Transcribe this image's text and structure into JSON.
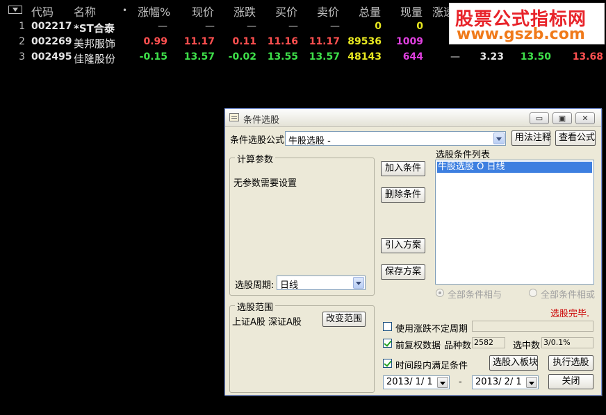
{
  "table": {
    "headers": {
      "code": "代码",
      "name": "名称",
      "dot": "•",
      "change_pct": "涨幅%",
      "price": "现价",
      "change": "涨跌",
      "bid": "买价",
      "ask": "卖价",
      "volume": "总量",
      "cur_volume": "现量",
      "speed": "涨速"
    },
    "rows": [
      {
        "idx": "1",
        "code": "002217",
        "name": "*ST合泰",
        "change_pct": "—",
        "price": "—",
        "change": "—",
        "bid": "—",
        "ask": "—",
        "volume": "0",
        "cur_volume": "0",
        "speed": "",
        "open": "",
        "high": "",
        "low": ""
      },
      {
        "idx": "2",
        "code": "002269",
        "name": "美邦服饰",
        "change_pct": "0.99",
        "price": "11.17",
        "change": "0.11",
        "bid": "11.16",
        "ask": "11.17",
        "volume": "89536",
        "cur_volume": "1009",
        "speed": "",
        "open": "",
        "high": "",
        "low": ""
      },
      {
        "idx": "3",
        "code": "002495",
        "name": "佳隆股份",
        "change_pct": "-0.15",
        "price": "13.57",
        "change": "-0.02",
        "bid": "13.55",
        "ask": "13.57",
        "volume": "48143",
        "cur_volume": "644",
        "speed": "—",
        "open": "3.23",
        "high": "13.50",
        "low": "13.68"
      }
    ]
  },
  "watermark": {
    "line1": "股票公式指标网",
    "line2": "www.gszb.com"
  },
  "dialog": {
    "title": "条件选股",
    "formula_label": "条件选股公式",
    "formula_value": "牛股选股 -",
    "usage_button": "用法注释",
    "view_formula_button": "查看公式",
    "calc_params_legend": "计算参数",
    "no_params_text": "无参数需要设置",
    "period_label": "选股周期:",
    "period_value": "日线",
    "add_condition_button": "加入条件",
    "delete_condition_button": "删除条件",
    "import_plan_button": "引入方案",
    "save_plan_button": "保存方案",
    "condition_list_label": "选股条件列表",
    "condition_items": [
      "牛股选股  O  日线"
    ],
    "radio_and_label": "全部条件相与",
    "radio_or_label": "全部条件相或",
    "status_text": "选股完毕.",
    "range_legend": "选股范围",
    "range_text": "上证A股 深证A股",
    "change_range_button": "改变范围",
    "use_unstable_period_label": "使用涨跌不定周期",
    "pre_adjust_label": "前复权数据",
    "count_label": "品种数",
    "count_value": "2582",
    "selected_label": "选中数",
    "selected_value": "3/0.1%",
    "time_period_label": "时间段内满足条件",
    "to_block_button": "选股入板块",
    "execute_button": "执行选股",
    "date_from": "2013/ 1/ 1",
    "date_sep": "-",
    "date_to": "2013/ 2/ 1",
    "close_button": "关闭"
  },
  "colors": {
    "up": "#ff5050",
    "down": "#3ee04a",
    "volume": "#e8e820",
    "cur_volume": "#e040e0",
    "status": "#cc0000",
    "selection": "#3d7fe0"
  }
}
